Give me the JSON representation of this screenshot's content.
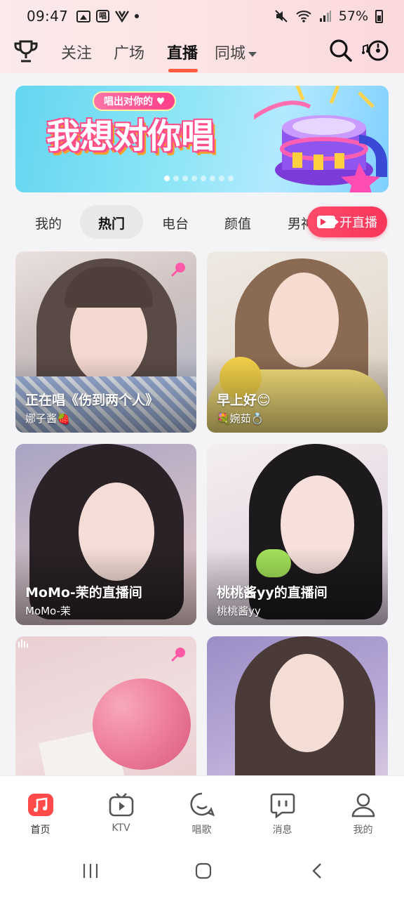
{
  "status_bar": {
    "time": "09:47",
    "app_tag": "唱",
    "battery": "57%"
  },
  "nav": {
    "tabs": [
      {
        "label": "关注"
      },
      {
        "label": "广场"
      },
      {
        "label": "直播"
      },
      {
        "label": "同城"
      }
    ],
    "active_tab": "直播"
  },
  "banner": {
    "subtitle": "唱出对你的",
    "title": "我想对你唱",
    "dot_count": 8,
    "active_dot": 0
  },
  "categories": {
    "tabs": [
      {
        "label": "我的"
      },
      {
        "label": "热门"
      },
      {
        "label": "电台"
      },
      {
        "label": "颜值"
      },
      {
        "label": "男神"
      }
    ],
    "active": "热门",
    "live_button": "开直播"
  },
  "rooms": [
    {
      "title": "正在唱《伤到两个人》",
      "host": "娜子酱🍓"
    },
    {
      "title": "早上好😊",
      "host": "💐婉茹💍"
    },
    {
      "title": "MoMo-茉的直播间",
      "host": "MoMo-茉"
    },
    {
      "title": "桃桃酱yy的直播间",
      "host": "桃桃酱yy"
    },
    {
      "title": "",
      "host": ""
    },
    {
      "title": "",
      "host": ""
    }
  ],
  "tab_bar": {
    "items": [
      {
        "label": "首页",
        "icon": "music-note-icon"
      },
      {
        "label": "KTV",
        "icon": "tv-play-icon"
      },
      {
        "label": "唱歌",
        "icon": "sing-bubble-icon"
      },
      {
        "label": "消息",
        "icon": "message-icon"
      },
      {
        "label": "我的",
        "icon": "person-icon"
      }
    ],
    "active": "首页"
  },
  "colors": {
    "accent": "#ff5a3c",
    "live_button": "#f7355a",
    "home_icon": "#ff4a4a"
  }
}
